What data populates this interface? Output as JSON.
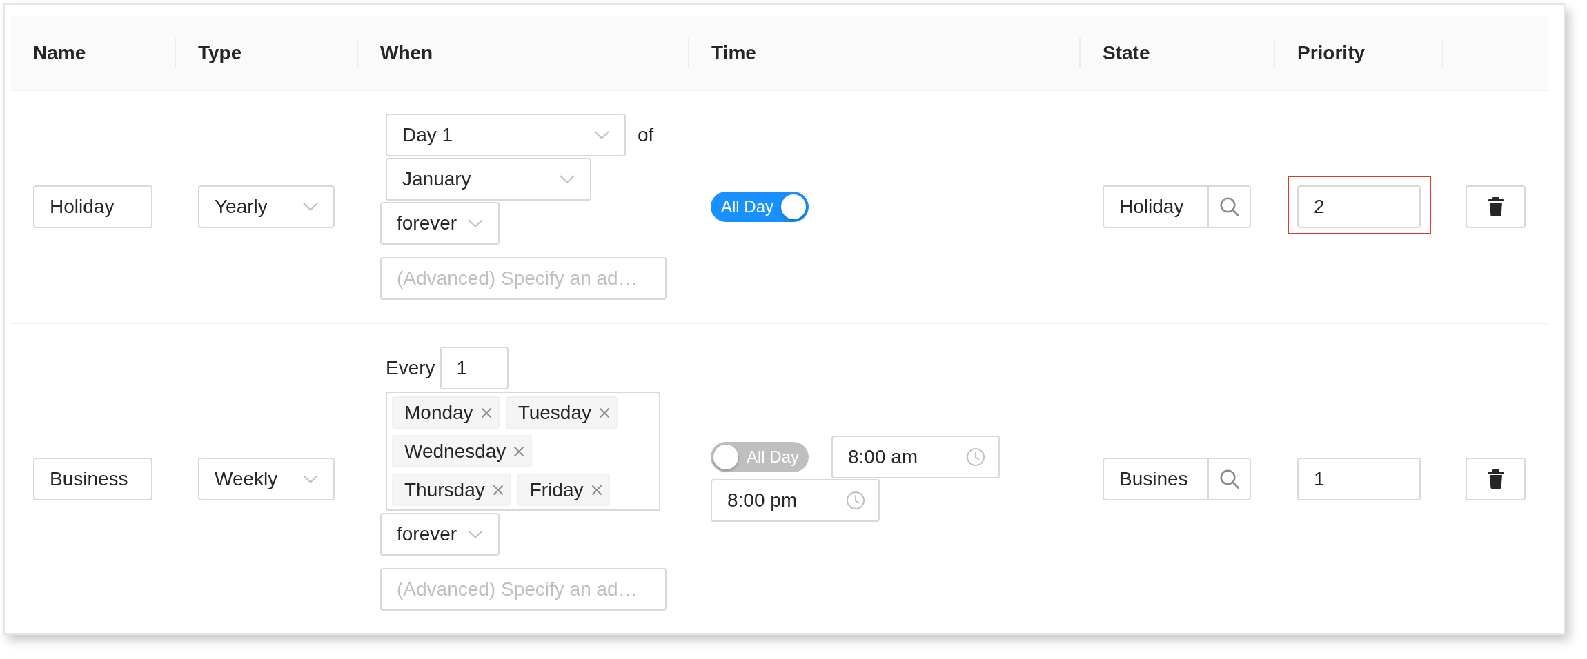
{
  "table": {
    "columns": [
      "Name",
      "Type",
      "When",
      "Time",
      "State",
      "Priority"
    ],
    "rows": [
      {
        "name": "Holiday",
        "type": "Yearly",
        "when": {
          "kind": "yearly",
          "day": "Day 1",
          "of_label": "of",
          "month": "January",
          "duration": "forever",
          "advanced_placeholder": "(Advanced) Specify an ad…"
        },
        "time": {
          "all_day_label": "All Day",
          "all_day": true
        },
        "state": "Holiday",
        "priority": {
          "value": "2",
          "highlighted": true
        }
      },
      {
        "name": "Business",
        "type": "Weekly",
        "when": {
          "kind": "weekly",
          "every_label": "Every",
          "every": "1",
          "days": [
            "Monday",
            "Tuesday",
            "Wednesday",
            "Thursday",
            "Friday"
          ],
          "duration": "forever",
          "advanced_placeholder": "(Advanced) Specify an ad…"
        },
        "time": {
          "all_day_label": "All Day",
          "all_day": false,
          "start": "8:00 am",
          "end": "8:00 pm"
        },
        "state": "Busines",
        "priority": {
          "value": "1",
          "highlighted": false
        }
      }
    ]
  }
}
